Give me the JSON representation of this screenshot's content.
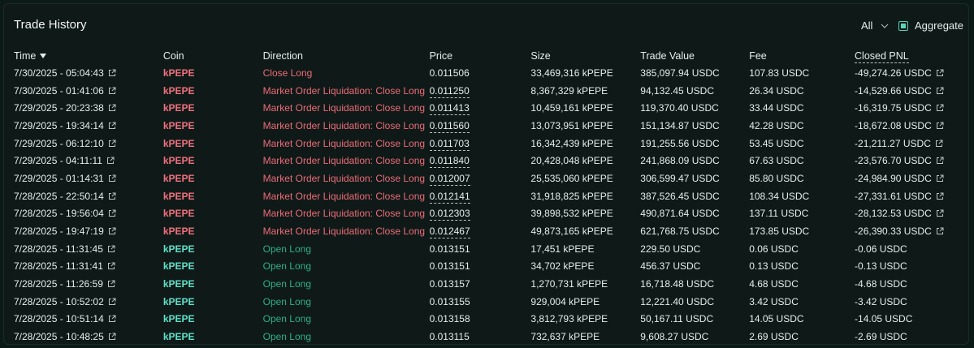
{
  "header": {
    "title": "Trade History",
    "filter_value": "All",
    "aggregate_label": "Aggregate",
    "aggregate_checked": true
  },
  "colors": {
    "sell": "#ec6b77",
    "buy": "#2fae86",
    "accent": "#5ad4bd"
  },
  "columns": [
    "Time",
    "Coin",
    "Direction",
    "Price",
    "Size",
    "Trade Value",
    "Fee",
    "Closed PNL"
  ],
  "rows": [
    {
      "time": "7/30/2025 - 05:04:43",
      "coin": "kPEPE",
      "direction": "Close Long",
      "side": "sell",
      "price": "0.011506",
      "price_dashed": false,
      "size": "33,469,316 kPEPE",
      "value": "385,097.94 USDC",
      "fee": "107.83 USDC",
      "pnl": "-49,274.26 USDC",
      "pnl_link": true
    },
    {
      "time": "7/30/2025 - 01:41:06",
      "coin": "kPEPE",
      "direction": "Market Order Liquidation: Close Long",
      "side": "sell",
      "price": "0.011250",
      "price_dashed": true,
      "size": "8,367,329 kPEPE",
      "value": "94,132.45 USDC",
      "fee": "26.34 USDC",
      "pnl": "-14,529.66 USDC",
      "pnl_link": true
    },
    {
      "time": "7/29/2025 - 20:23:38",
      "coin": "kPEPE",
      "direction": "Market Order Liquidation: Close Long",
      "side": "sell",
      "price": "0.011413",
      "price_dashed": true,
      "size": "10,459,161 kPEPE",
      "value": "119,370.40 USDC",
      "fee": "33.44 USDC",
      "pnl": "-16,319.75 USDC",
      "pnl_link": true
    },
    {
      "time": "7/29/2025 - 19:34:14",
      "coin": "kPEPE",
      "direction": "Market Order Liquidation: Close Long",
      "side": "sell",
      "price": "0.011560",
      "price_dashed": true,
      "size": "13,073,951 kPEPE",
      "value": "151,134.87 USDC",
      "fee": "42.28 USDC",
      "pnl": "-18,672.08 USDC",
      "pnl_link": true
    },
    {
      "time": "7/29/2025 - 06:12:10",
      "coin": "kPEPE",
      "direction": "Market Order Liquidation: Close Long",
      "side": "sell",
      "price": "0.011703",
      "price_dashed": true,
      "size": "16,342,439 kPEPE",
      "value": "191,255.56 USDC",
      "fee": "53.45 USDC",
      "pnl": "-21,211.27 USDC",
      "pnl_link": true
    },
    {
      "time": "7/29/2025 - 04:11:11",
      "coin": "kPEPE",
      "direction": "Market Order Liquidation: Close Long",
      "side": "sell",
      "price": "0.011840",
      "price_dashed": true,
      "size": "20,428,048 kPEPE",
      "value": "241,868.09 USDC",
      "fee": "67.63 USDC",
      "pnl": "-23,576.70 USDC",
      "pnl_link": true
    },
    {
      "time": "7/29/2025 - 01:14:31",
      "coin": "kPEPE",
      "direction": "Market Order Liquidation: Close Long",
      "side": "sell",
      "price": "0.012007",
      "price_dashed": true,
      "size": "25,535,060 kPEPE",
      "value": "306,599.47 USDC",
      "fee": "85.80 USDC",
      "pnl": "-24,984.90 USDC",
      "pnl_link": true
    },
    {
      "time": "7/28/2025 - 22:50:14",
      "coin": "kPEPE",
      "direction": "Market Order Liquidation: Close Long",
      "side": "sell",
      "price": "0.012141",
      "price_dashed": true,
      "size": "31,918,825 kPEPE",
      "value": "387,526.45 USDC",
      "fee": "108.34 USDC",
      "pnl": "-27,331.61 USDC",
      "pnl_link": true
    },
    {
      "time": "7/28/2025 - 19:56:04",
      "coin": "kPEPE",
      "direction": "Market Order Liquidation: Close Long",
      "side": "sell",
      "price": "0.012303",
      "price_dashed": true,
      "size": "39,898,532 kPEPE",
      "value": "490,871.64 USDC",
      "fee": "137.11 USDC",
      "pnl": "-28,132.53 USDC",
      "pnl_link": true
    },
    {
      "time": "7/28/2025 - 19:47:19",
      "coin": "kPEPE",
      "direction": "Market Order Liquidation: Close Long",
      "side": "sell",
      "price": "0.012467",
      "price_dashed": true,
      "size": "49,873,165 kPEPE",
      "value": "621,768.75 USDC",
      "fee": "173.85 USDC",
      "pnl": "-26,390.33 USDC",
      "pnl_link": true
    },
    {
      "time": "7/28/2025 - 11:31:45",
      "coin": "kPEPE",
      "direction": "Open Long",
      "side": "buy",
      "price": "0.013151",
      "price_dashed": false,
      "size": "17,451 kPEPE",
      "value": "229.50 USDC",
      "fee": "0.06 USDC",
      "pnl": "-0.06 USDC",
      "pnl_link": false
    },
    {
      "time": "7/28/2025 - 11:31:41",
      "coin": "kPEPE",
      "direction": "Open Long",
      "side": "buy",
      "price": "0.013151",
      "price_dashed": false,
      "size": "34,702 kPEPE",
      "value": "456.37 USDC",
      "fee": "0.13 USDC",
      "pnl": "-0.13 USDC",
      "pnl_link": false
    },
    {
      "time": "7/28/2025 - 11:26:59",
      "coin": "kPEPE",
      "direction": "Open Long",
      "side": "buy",
      "price": "0.013157",
      "price_dashed": false,
      "size": "1,270,731 kPEPE",
      "value": "16,718.48 USDC",
      "fee": "4.68 USDC",
      "pnl": "-4.68 USDC",
      "pnl_link": false
    },
    {
      "time": "7/28/2025 - 10:52:02",
      "coin": "kPEPE",
      "direction": "Open Long",
      "side": "buy",
      "price": "0.013155",
      "price_dashed": false,
      "size": "929,004 kPEPE",
      "value": "12,221.40 USDC",
      "fee": "3.42 USDC",
      "pnl": "-3.42 USDC",
      "pnl_link": false
    },
    {
      "time": "7/28/2025 - 10:51:14",
      "coin": "kPEPE",
      "direction": "Open Long",
      "side": "buy",
      "price": "0.013158",
      "price_dashed": false,
      "size": "3,812,793 kPEPE",
      "value": "50,167.11 USDC",
      "fee": "14.05 USDC",
      "pnl": "-14.05 USDC",
      "pnl_link": false
    },
    {
      "time": "7/28/2025 - 10:48:25",
      "coin": "kPEPE",
      "direction": "Open Long",
      "side": "buy",
      "price": "0.013115",
      "price_dashed": false,
      "size": "732,637 kPEPE",
      "value": "9,608.27 USDC",
      "fee": "2.69 USDC",
      "pnl": "-2.69 USDC",
      "pnl_link": false
    }
  ]
}
